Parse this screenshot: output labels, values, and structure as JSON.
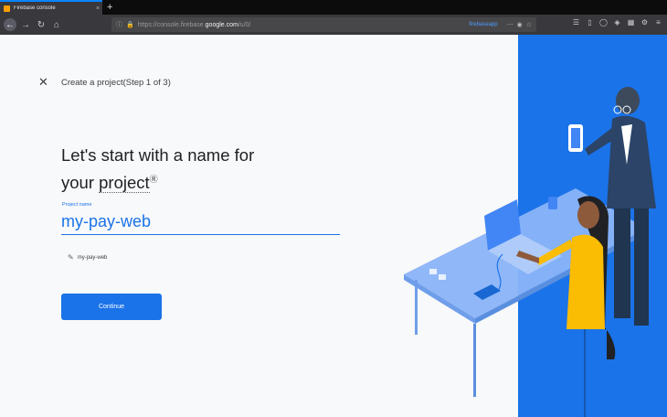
{
  "browser": {
    "tab_title": "Firebase console",
    "tab_close": "×",
    "new_tab": "+",
    "url_prefix": "https://console.firebase.",
    "url_domain": "google.com",
    "url_suffix": "/u/0/",
    "url_badge": "firebaseapp"
  },
  "page": {
    "step_title": "Create a project(Step 1 of 3)",
    "heading_line1": "Let's start with a name for",
    "heading_line2_prefix": "your ",
    "heading_line2_word": "project",
    "help_icon": "?",
    "field_label": "Project name",
    "field_value": "my-pay-web",
    "project_id": "my-pay-web",
    "continue_label": "Continue"
  },
  "colors": {
    "accent": "#1a73e8",
    "panel_blue": "#1a73e8",
    "chrome_dark": "#38383d"
  }
}
